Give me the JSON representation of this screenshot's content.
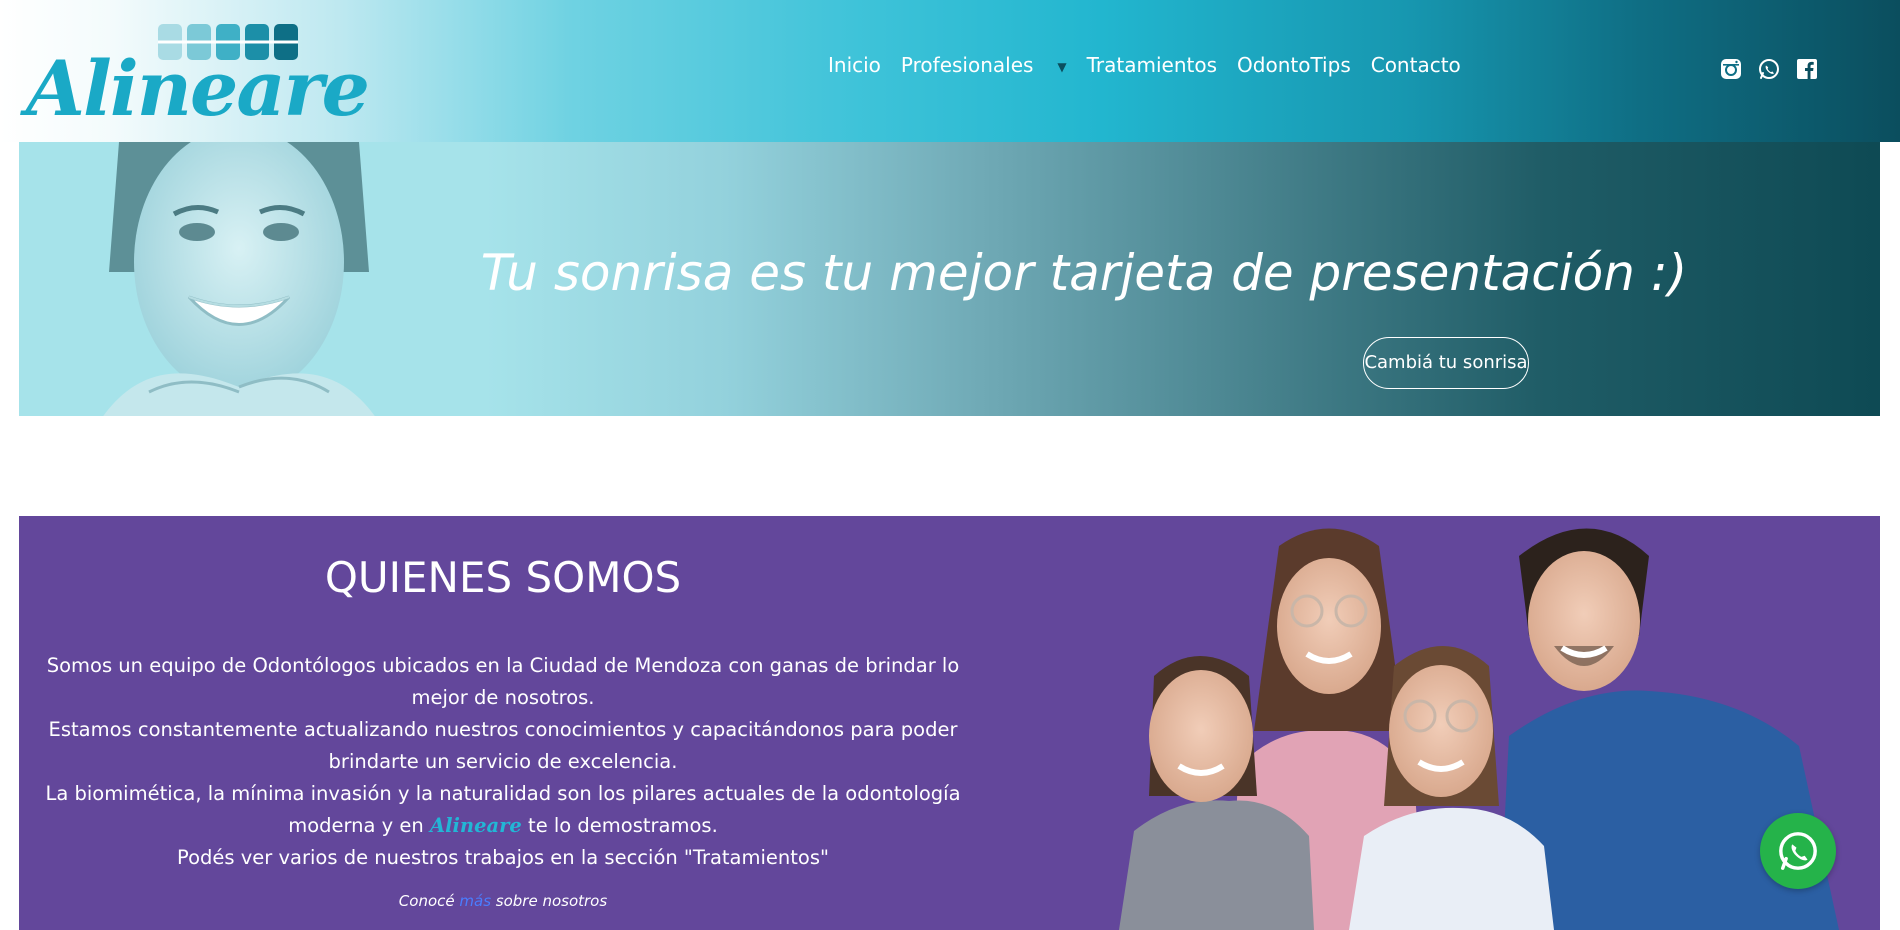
{
  "brand": {
    "name": "Alineare",
    "accent": "#1aa9c6",
    "logo_tile_colors": [
      "#a9dbe4",
      "#7cc9d7",
      "#3fb0c6",
      "#1c8fa8",
      "#0e6f86"
    ]
  },
  "nav": {
    "items": [
      {
        "label": "Inicio"
      },
      {
        "label": "Profesionales",
        "has_dropdown": true
      },
      {
        "label": "Tratamientos"
      },
      {
        "label": "OdontoTips"
      },
      {
        "label": "Contacto"
      }
    ]
  },
  "social": {
    "icons": [
      "instagram-icon",
      "whatsapp-icon",
      "facebook-icon"
    ]
  },
  "hero": {
    "title": "Tu sonrisa es tu mejor tarjeta de presentación :)",
    "button_label": "Cambiá tu sonrisa"
  },
  "about": {
    "title": "QUIENES SOMOS",
    "line1": "Somos un equipo de Odontólogos ubicados en la Ciudad de Mendoza con ganas de brindar lo mejor de nosotros.",
    "line2": "Estamos constantemente actualizando nuestros conocimientos y capacitándonos para poder brindarte un servicio de excelencia.",
    "line3_before": "La biomimética, la mínima invasión y la naturalidad son los pilares actuales de la odontología moderna y en ",
    "line3_brand": "Alineare",
    "line3_after": " te lo demostramos.",
    "line4": "Podés ver varios de nuestros trabajos en la sección \"Tratamientos\"",
    "more_before": "Conocé ",
    "more_link": "más",
    "more_after": " sobre nosotros",
    "background": "#63479b"
  },
  "floating": {
    "icon": "whatsapp-icon",
    "color": "#25b34a"
  }
}
